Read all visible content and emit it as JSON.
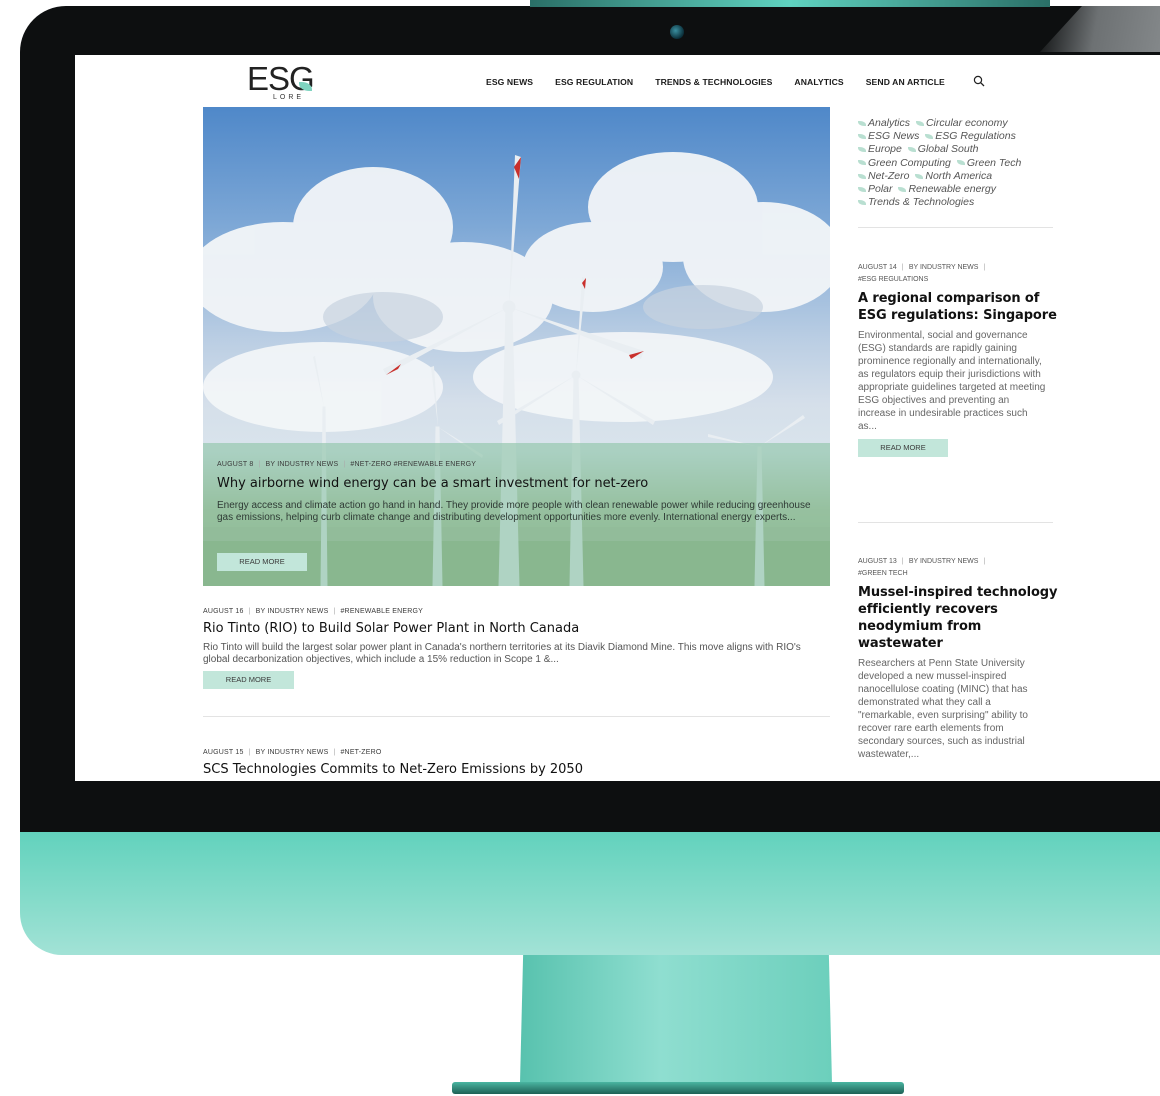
{
  "header": {
    "logo_text": "ESG",
    "logo_sub": "LORE",
    "nav": [
      "ESG NEWS",
      "ESG REGULATION",
      "TRENDS & TECHNOLOGIES",
      "ANALYTICS",
      "SEND AN ARTICLE"
    ]
  },
  "featured": {
    "date": "AUGUST 8",
    "author": "BY INDUSTRY NEWS",
    "tags": "#NET-ZERO #RENEWABLE ENERGY",
    "title": "Why airborne wind energy can be a smart investment for net-zero",
    "excerpt": "Energy access and climate action go hand in hand. They provide more people with clean renewable power while reducing greenhouse gas emissions, helping curb climate change and distributing development opportunities more evenly. International energy experts...",
    "button": "READ MORE"
  },
  "articles": [
    {
      "date": "AUGUST 16",
      "author": "BY INDUSTRY NEWS",
      "tags": "#RENEWABLE ENERGY",
      "title": "Rio Tinto (RIO) to Build Solar Power Plant in North Canada",
      "excerpt": "Rio Tinto will build the largest solar power plant in Canada's northern territories at its Diavik Diamond Mine. This move aligns with RIO's global decarbonization objectives, which include a 15% reduction in Scope 1 &...",
      "button": "READ MORE"
    },
    {
      "date": "AUGUST 15",
      "author": "BY INDUSTRY NEWS",
      "tags": "#NET-ZERO",
      "title": "SCS Technologies Commits to Net-Zero Emissions by 2050"
    }
  ],
  "sidebar": {
    "tags": [
      "Analytics",
      "Circular economy",
      "ESG News",
      "ESG Regulations",
      "Europe",
      "Global South",
      "Green Computing",
      "Green Tech",
      "Net-Zero",
      "North America",
      "Polar",
      "Renewable energy",
      "Trends & Technologies"
    ],
    "posts": [
      {
        "date": "AUGUST 14",
        "author": "BY INDUSTRY NEWS",
        "tags": "#ESG REGULATIONS",
        "title": "A regional comparison of ESG regulations: Singapore",
        "excerpt": "Environmental, social and governance (ESG) standards are rapidly gaining prominence regionally and internationally, as regulators equip their jurisdictions with appropriate guidelines targeted at meeting ESG objectives and preventing an increase in undesirable practices such as...",
        "button": "READ MORE"
      },
      {
        "date": "AUGUST 13",
        "author": "BY INDUSTRY NEWS",
        "tags": "#GREEN TECH",
        "title": "Mussel-inspired technology efficiently recovers neodymium from wastewater",
        "excerpt": "Researchers at Penn State University developed a new mussel-inspired nanocellulose coating (MINC) that has demonstrated what they call a \"remarkable, even surprising\" ability to recover rare earth elements from secondary sources, such as industrial wastewater,..."
      }
    ]
  },
  "colors": {
    "accent": "#c2e6da",
    "monitor_teal": "#6fd5c2",
    "bezel": "#0d0f10"
  },
  "icons": {
    "search": "search-icon",
    "camera": "camera-icon"
  }
}
